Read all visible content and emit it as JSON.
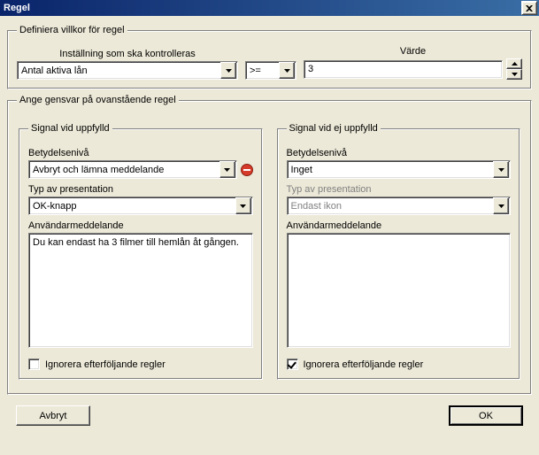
{
  "title": "Regel",
  "groups": {
    "define": {
      "legend": "Definiera villkor för regel",
      "setting_label": "Inställning som ska kontrolleras",
      "setting_value": "Antal aktiva lån",
      "operator_value": ">=",
      "value_label": "Värde",
      "value": "3"
    },
    "response": {
      "legend": "Ange gensvar på ovanstående regel",
      "fulfilled": {
        "legend": "Signal vid uppfylld",
        "level_label": "Betydelsenivå",
        "level_value": "Avbryt och lämna meddelande",
        "presentation_label": "Typ av presentation",
        "presentation_value": "OK-knapp",
        "message_label": "Användarmeddelande",
        "message_value": "Du kan endast ha 3 filmer till hemlån åt gången.",
        "ignore_label": "Ignorera efterföljande regler",
        "ignore_checked": false
      },
      "unfulfilled": {
        "legend": "Signal vid ej uppfylld",
        "level_label": "Betydelsenivå",
        "level_value": "Inget",
        "presentation_label": "Typ av presentation",
        "presentation_value": "Endast ikon",
        "message_label": "Användarmeddelande",
        "message_value": "",
        "ignore_label": "Ignorera efterföljande regler",
        "ignore_checked": true
      }
    }
  },
  "buttons": {
    "cancel": "Avbryt",
    "ok": "OK"
  }
}
